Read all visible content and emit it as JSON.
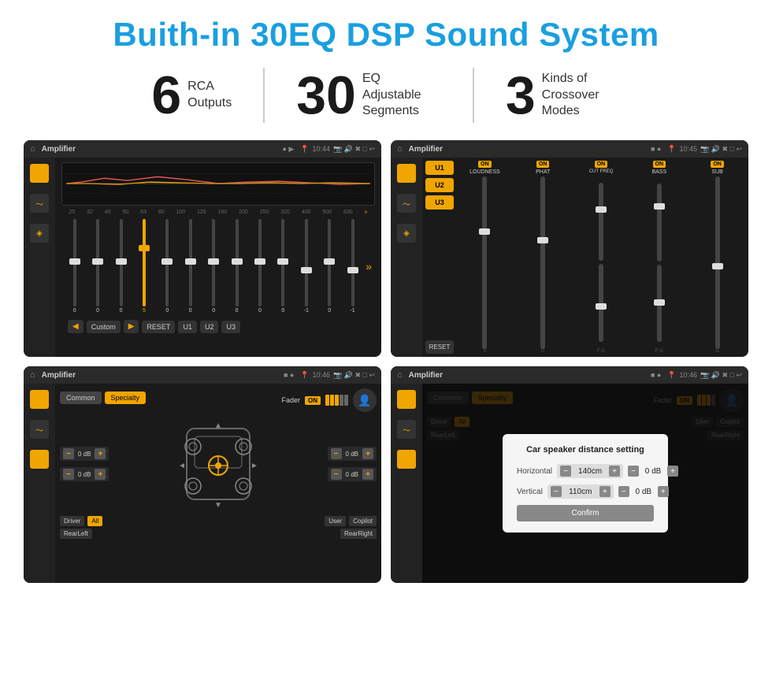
{
  "title": "Buith-in 30EQ DSP Sound System",
  "stats": [
    {
      "number": "6",
      "label": "RCA\nOutputs",
      "label_line1": "RCA",
      "label_line2": "Outputs"
    },
    {
      "number": "30",
      "label": "EQ Adjustable\nSegments",
      "label_line1": "EQ Adjustable",
      "label_line2": "Segments"
    },
    {
      "number": "3",
      "label": "Kinds of\nCrossover Modes",
      "label_line1": "Kinds of",
      "label_line2": "Crossover Modes"
    }
  ],
  "screenshots": [
    {
      "id": "ss1",
      "app": "Amplifier",
      "time": "10:44",
      "freq_labels": [
        "25",
        "32",
        "40",
        "50",
        "63",
        "80",
        "100",
        "125",
        "160",
        "200",
        "250",
        "320",
        "400",
        "500",
        "630"
      ],
      "slider_values": [
        "0",
        "0",
        "0",
        "5",
        "0",
        "0",
        "0",
        "0",
        "0",
        "0",
        "-1",
        "0",
        "-1"
      ],
      "buttons": [
        "◀",
        "Custom",
        "▶",
        "RESET",
        "U1",
        "U2",
        "U3"
      ]
    },
    {
      "id": "ss2",
      "app": "Amplifier",
      "time": "10:45",
      "presets": [
        "U1",
        "U2",
        "U3"
      ],
      "band_labels": [
        "LOUDNESS",
        "PHAT",
        "CUT FREQ",
        "BASS",
        "SUB"
      ],
      "reset_label": "RESET"
    },
    {
      "id": "ss3",
      "app": "Amplifier",
      "time": "10:46",
      "tabs": [
        "Common",
        "Specialty"
      ],
      "fader_label": "Fader",
      "fader_on": "ON",
      "db_values": [
        "0 dB",
        "0 dB",
        "0 dB",
        "0 dB"
      ],
      "bottom_labels": [
        "Driver",
        "All",
        "User",
        "Copilot",
        "RearLeft",
        "RearRight"
      ]
    },
    {
      "id": "ss4",
      "app": "Amplifier",
      "time": "10:46",
      "dialog": {
        "title": "Car speaker distance setting",
        "horizontal_label": "Horizontal",
        "horizontal_value": "140cm",
        "vertical_label": "Vertical",
        "vertical_value": "110cm",
        "confirm_label": "Confirm"
      },
      "bottom_labels": [
        "Driver",
        "All",
        "User",
        "Copilot",
        "RearLeft",
        "RearRight"
      ]
    }
  ],
  "colors": {
    "title_blue": "#1a9fe0",
    "accent_orange": "#f0a500",
    "dark_bg": "#1a1a1a",
    "text_light": "#cccccc"
  }
}
